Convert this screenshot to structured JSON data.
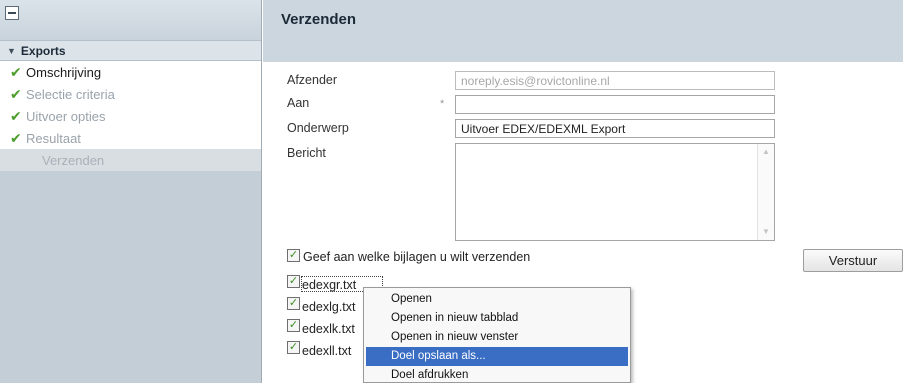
{
  "sidebar": {
    "section_title": "Exports",
    "items": [
      {
        "label": "Omschrijving",
        "state": "active"
      },
      {
        "label": "Selectie criteria",
        "state": "done"
      },
      {
        "label": "Uitvoer opties",
        "state": "done"
      },
      {
        "label": "Resultaat",
        "state": "done"
      },
      {
        "label": "Verzenden",
        "state": "current"
      }
    ]
  },
  "main": {
    "title": "Verzenden",
    "form": {
      "sender_label": "Afzender",
      "sender_value": "noreply.esis@rovictonline.nl",
      "to_label": "Aan",
      "to_required": "*",
      "to_value": "",
      "subject_label": "Onderwerp",
      "subject_value": "Uitvoer EDEX/EDEXML Export",
      "message_label": "Bericht",
      "message_value": ""
    },
    "attachments": {
      "toggle_label": "Geef aan welke bijlagen u wilt verzenden",
      "files": [
        "edexgr.txt",
        "edexlg.txt",
        "edexlk.txt",
        "edexll.txt"
      ]
    },
    "send_button": "Verstuur"
  },
  "context_menu": {
    "items": [
      "Openen",
      "Openen in nieuw tabblad",
      "Openen in nieuw venster",
      "Doel opslaan als...",
      "Doel afdrukken"
    ],
    "highlighted": "Doel opslaan als..."
  },
  "colors": {
    "check_green": "#4b9d2a",
    "menu_highlight": "#3a6dc4",
    "header_bg": "#ccd6de"
  }
}
